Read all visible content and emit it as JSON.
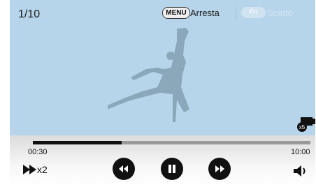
{
  "player": {
    "counter": "1/10",
    "hint": {
      "stop_key": "MENU",
      "stop_label": "Arresta",
      "shot_key": "Fn",
      "shot_label": "Scatto"
    },
    "time_current": "00:30",
    "time_total": "10:00",
    "progress": 0.32,
    "speed_label": "x2",
    "repeat_icon_label": "x5"
  },
  "icons": [
    "fast-forward-speed-icon",
    "rewind-icon",
    "pause-icon",
    "forward-icon",
    "volume-icon",
    "camera-icon"
  ]
}
